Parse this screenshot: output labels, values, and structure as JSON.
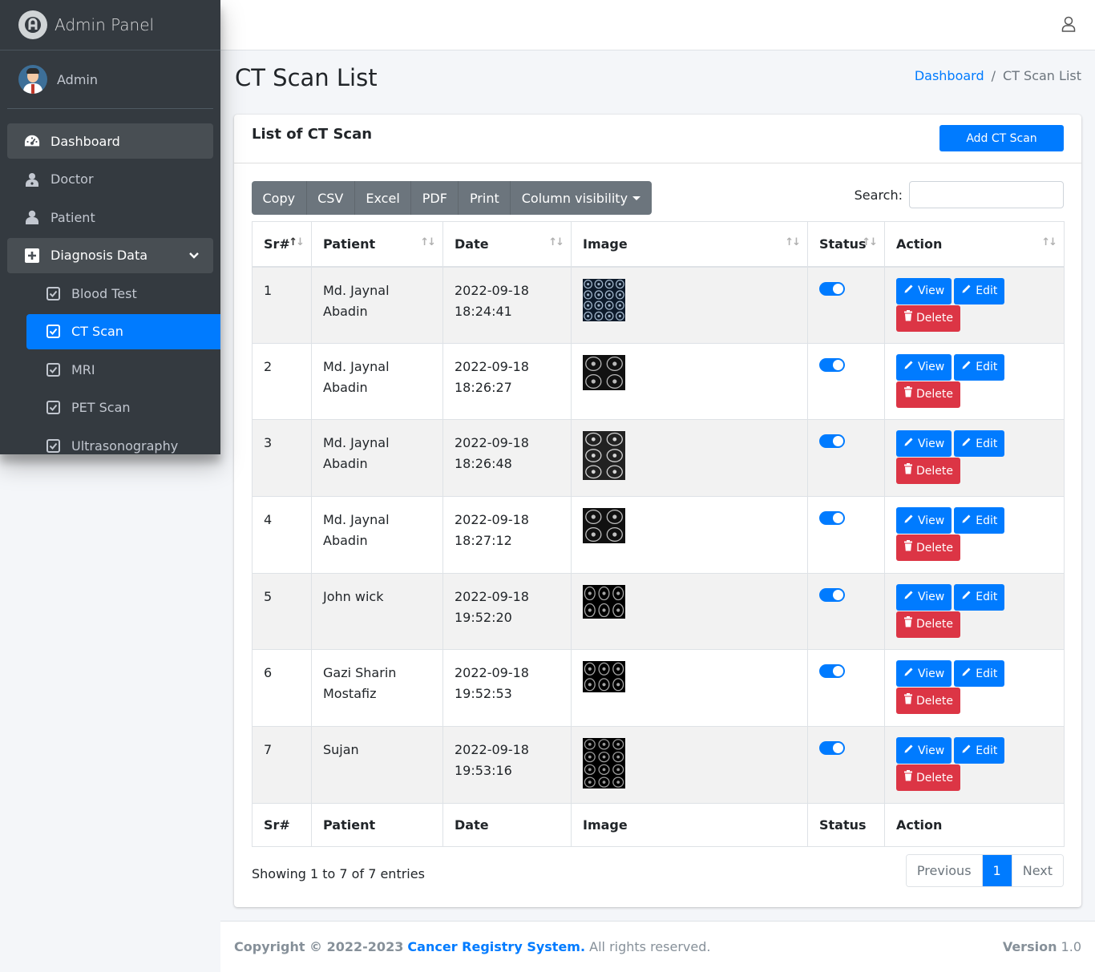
{
  "brand": {
    "title": "Admin Panel"
  },
  "user": {
    "name": "Admin"
  },
  "sidebar": {
    "items": [
      {
        "label": "Dashboard",
        "icon": "dashboard-icon"
      },
      {
        "label": "Doctor",
        "icon": "user-doctor-icon"
      },
      {
        "label": "Patient",
        "icon": "user-icon"
      },
      {
        "label": "Diagnosis Data",
        "icon": "plus-square-icon"
      },
      {
        "label": "Blood Test",
        "icon": "check-square-icon"
      },
      {
        "label": "CT Scan",
        "icon": "check-square-icon"
      },
      {
        "label": "MRI",
        "icon": "check-square-icon"
      },
      {
        "label": "PET Scan",
        "icon": "check-square-icon"
      },
      {
        "label": "Ultrasonography",
        "icon": "check-square-icon"
      }
    ]
  },
  "header": {
    "title": "CT Scan List"
  },
  "breadcrumb": {
    "home": "Dashboard",
    "separator": "/",
    "current": "CT Scan List"
  },
  "card": {
    "title": "List of CT Scan",
    "add_label": "Add CT Scan"
  },
  "toolbar": {
    "buttons": [
      "Copy",
      "CSV",
      "Excel",
      "PDF",
      "Print",
      "Column visibility"
    ]
  },
  "search": {
    "label": "Search:",
    "value": ""
  },
  "table": {
    "columns": [
      "Sr#",
      "Patient",
      "Date",
      "Image",
      "Status",
      "Action"
    ],
    "rows": [
      {
        "sr": "1",
        "patient": "Md. Jaynal Abadin",
        "date": "2022-09-18",
        "time": "18:24:41",
        "status": true
      },
      {
        "sr": "2",
        "patient": "Md. Jaynal Abadin",
        "date": "2022-09-18",
        "time": "18:26:27",
        "status": true
      },
      {
        "sr": "3",
        "patient": "Md. Jaynal Abadin",
        "date": "2022-09-18",
        "time": "18:26:48",
        "status": true
      },
      {
        "sr": "4",
        "patient": "Md. Jaynal Abadin",
        "date": "2022-09-18",
        "time": "18:27:12",
        "status": true
      },
      {
        "sr": "5",
        "patient": "John wick",
        "date": "2022-09-18",
        "time": "19:52:20",
        "status": true
      },
      {
        "sr": "6",
        "patient": "Gazi Sharin Mostafiz",
        "date": "2022-09-18",
        "time": "19:52:53",
        "status": true
      },
      {
        "sr": "7",
        "patient": "Sujan",
        "date": "2022-09-18",
        "time": "19:53:16",
        "status": true
      }
    ],
    "actions": {
      "view": "View",
      "edit": "Edit",
      "delete": "Delete"
    }
  },
  "info": "Showing 1 to 7 of 7 entries",
  "pagination": {
    "previous": "Previous",
    "current": "1",
    "next": "Next"
  },
  "footer": {
    "copyright": "Copyright © 2022-2023",
    "brand": "Cancer Registry System.",
    "rights": "All rights reserved.",
    "version_label": "Version",
    "version": "1.0"
  },
  "colors": {
    "primary": "#007bff",
    "danger": "#dc3545",
    "sidebar": "#343a40",
    "toolbar": "#6c757d"
  }
}
